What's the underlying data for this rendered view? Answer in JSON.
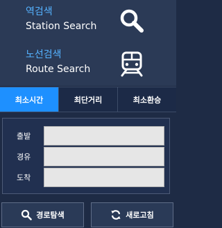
{
  "menu": {
    "station": {
      "korean": "역검색",
      "english": "Station Search",
      "icon": "search-icon"
    },
    "route": {
      "korean": "노선검색",
      "english": "Route Search",
      "icon": "train-icon"
    }
  },
  "tabs": [
    {
      "label": "최소시간",
      "active": true
    },
    {
      "label": "최단거리",
      "active": false
    },
    {
      "label": "최소환승",
      "active": false
    }
  ],
  "form": {
    "departure_label": "출발",
    "via_label": "경유",
    "arrival_label": "도착",
    "departure_value": "",
    "via_value": "",
    "arrival_value": ""
  },
  "buttons": {
    "route_search_label": "경로탐색",
    "refresh_label": "새로고침"
  },
  "colors": {
    "accent": "#1e90ff",
    "korean_text": "#55b2ff"
  }
}
